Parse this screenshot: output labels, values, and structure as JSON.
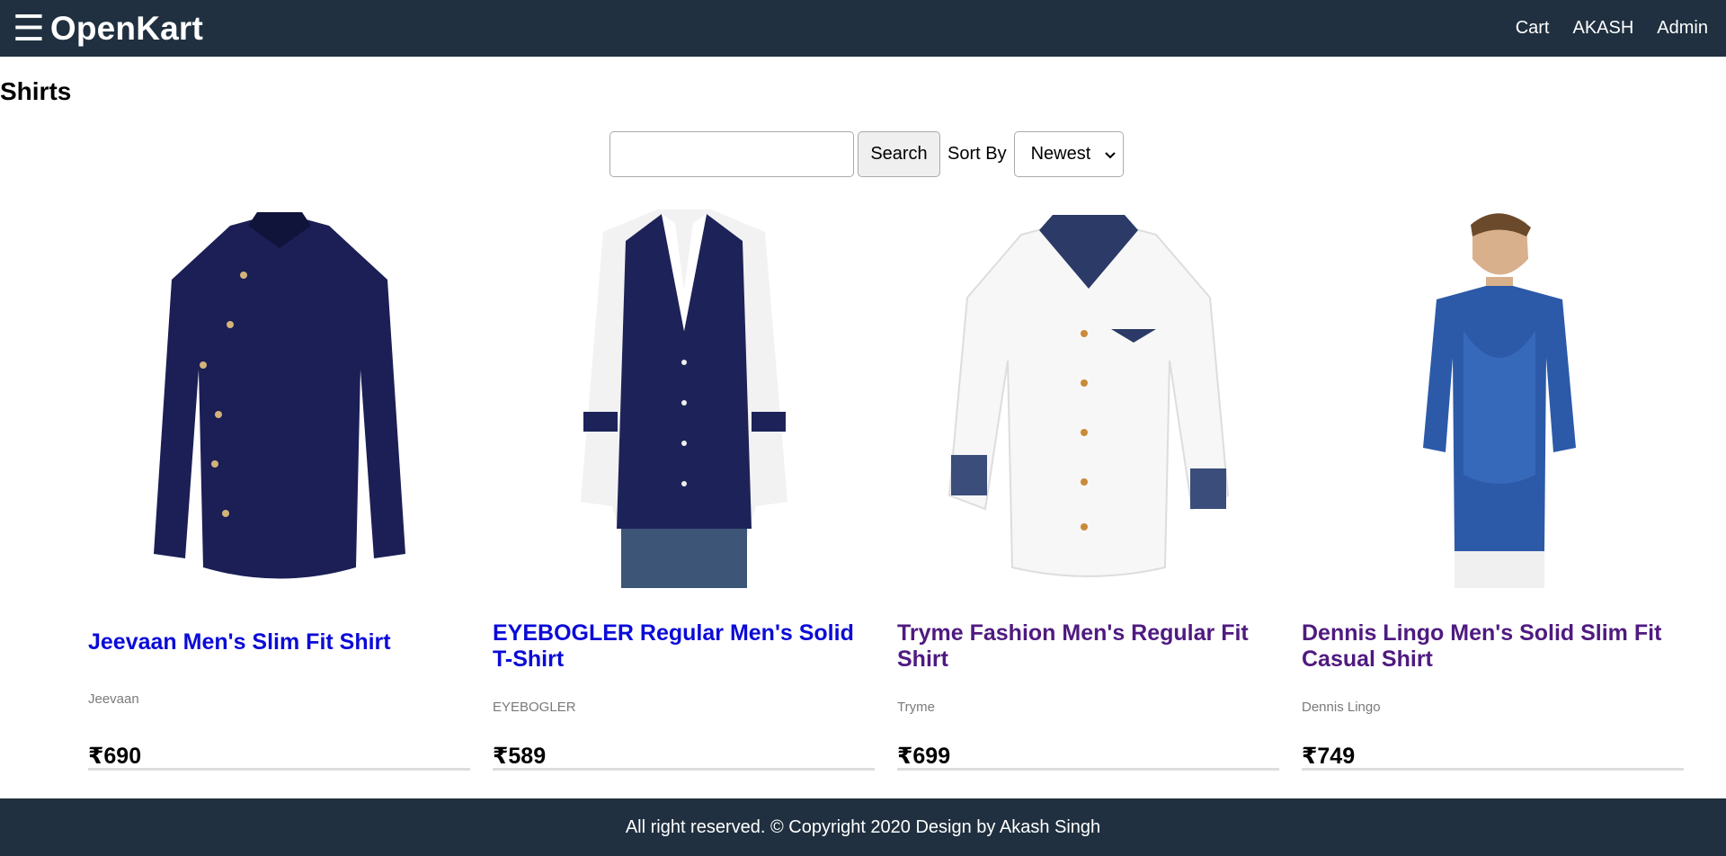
{
  "header": {
    "menu_icon": "hamburger-menu-icon",
    "brand": "OpenKart",
    "links": [
      "Cart",
      "AKASH",
      "Admin"
    ]
  },
  "page": {
    "title": "Shirts"
  },
  "filters": {
    "search_value": "",
    "search_placeholder": "",
    "search_button": "Search",
    "sort_label": "Sort By",
    "sort_selected": "Newest"
  },
  "products": [
    {
      "name": "Jeevaan Men's Slim Fit Shirt",
      "brand": "Jeevaan",
      "price": "₹690",
      "link_state": "unvisited"
    },
    {
      "name": "EYEBOGLER Regular Men's Solid T-Shirt",
      "brand": "EYEBOGLER",
      "price": "₹589",
      "link_state": "unvisited"
    },
    {
      "name": "Tryme Fashion Men's Regular Fit Shirt",
      "brand": "Tryme",
      "price": "₹699",
      "link_state": "visited"
    },
    {
      "name": "Dennis Lingo Men's Solid Slim Fit Casual Shirt",
      "brand": "Dennis Lingo",
      "price": "₹749",
      "link_state": "visited"
    }
  ],
  "footer": {
    "text": "All right reserved. © Copyright 2020 Design by Akash Singh"
  },
  "colors": {
    "header_bg": "#203040",
    "link_unvisited": "#0b0bd8",
    "link_visited": "#4f1a80"
  }
}
